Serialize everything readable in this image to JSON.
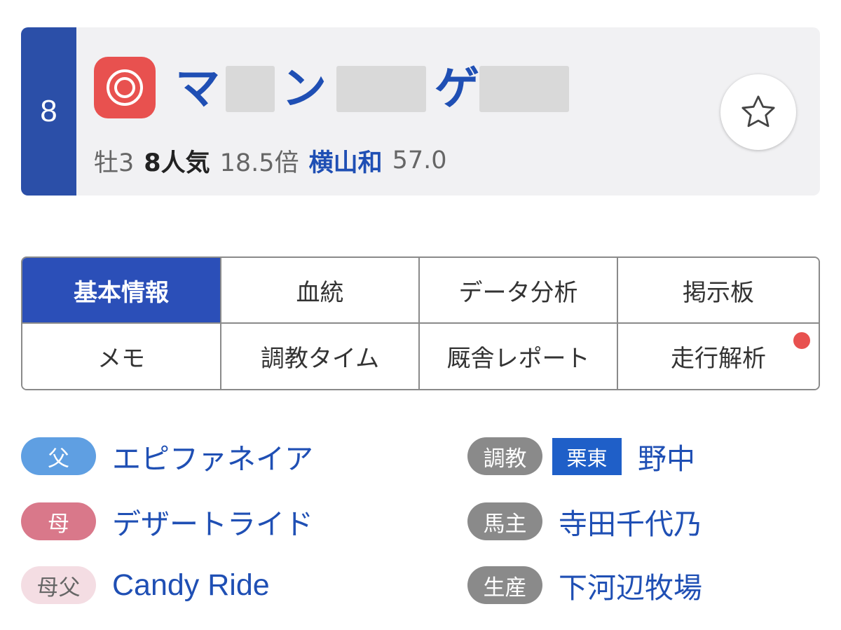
{
  "horse": {
    "post_number": "8",
    "mark_icon": "double-circle-icon",
    "name_char_1": "マ",
    "name_char_2": "ン",
    "name_char_3": "ゲ",
    "sex_age": "牡3",
    "popularity": "8人気",
    "odds": "18.5倍",
    "jockey": "横山和",
    "weight": "57.0"
  },
  "tabs": [
    {
      "label": "基本情報",
      "active": true
    },
    {
      "label": "血統",
      "active": false
    },
    {
      "label": "データ分析",
      "active": false
    },
    {
      "label": "掲示板",
      "active": false
    },
    {
      "label": "メモ",
      "active": false
    },
    {
      "label": "調教タイム",
      "active": false
    },
    {
      "label": "厩舎レポート",
      "active": false
    },
    {
      "label": "走行解析",
      "active": false,
      "notice": true
    }
  ],
  "pedigree": {
    "sire_label": "父",
    "sire": "エピファネイア",
    "dam_label": "母",
    "dam": "デザートライド",
    "damsire_label": "母父",
    "damsire": "Candy Ride"
  },
  "connections": {
    "trainer_label": "調教",
    "region": "栗東",
    "trainer": "野中",
    "owner_label": "馬主",
    "owner": "寺田千代乃",
    "breeder_label": "生産",
    "breeder": "下河辺牧場"
  },
  "colors": {
    "accent": "#2b4fb8",
    "name": "#1f4fb4",
    "mark": "#e8514f"
  }
}
